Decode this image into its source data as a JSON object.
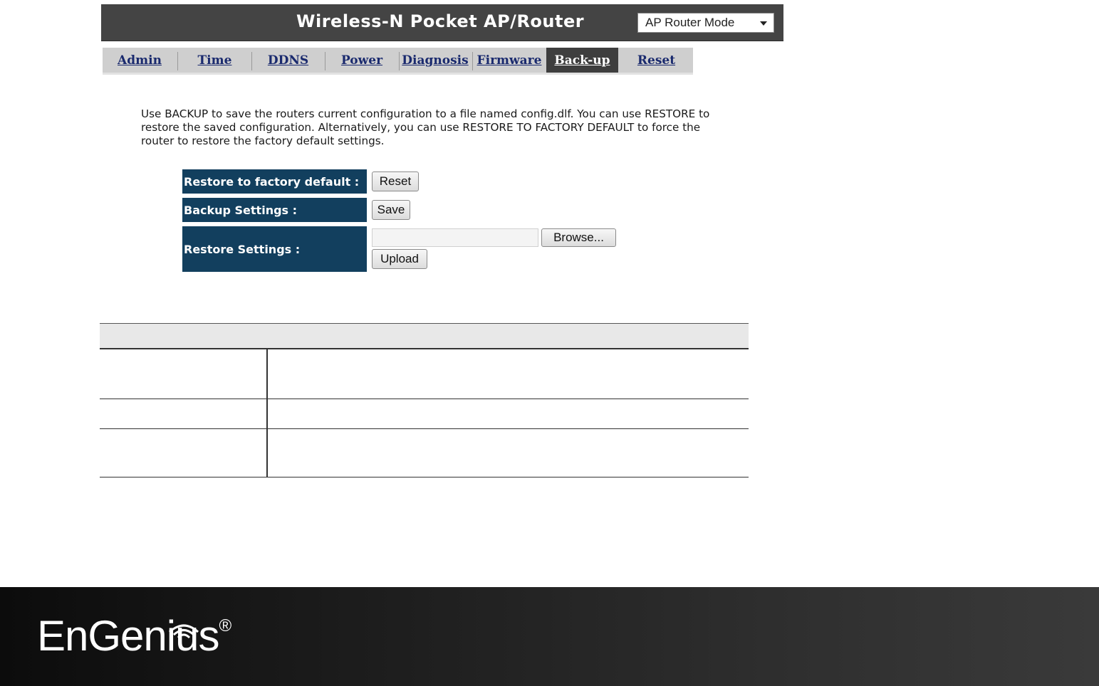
{
  "header": {
    "title": "Wireless-N Pocket AP/Router",
    "mode_select": {
      "selected": "AP Router Mode"
    }
  },
  "tabs": [
    {
      "label": "Admin"
    },
    {
      "label": "Time"
    },
    {
      "label": "DDNS"
    },
    {
      "label": "Power"
    },
    {
      "label": "Diagnosis"
    },
    {
      "label": "Firmware"
    },
    {
      "label": "Back-up",
      "active": true
    },
    {
      "label": "Reset"
    }
  ],
  "description": "Use BACKUP to save the routers current configuration to a file named config.dlf. You can use RESTORE to restore the saved configuration. Alternatively, you can use RESTORE TO FACTORY DEFAULT to force the router to restore the factory default settings.",
  "settings": {
    "factory_default": {
      "label": "Restore to factory default :",
      "button": "Reset"
    },
    "backup": {
      "label": "Backup Settings :",
      "button": "Save"
    },
    "restore": {
      "label": "Restore Settings :",
      "file_value": "",
      "browse_button": "Browse...",
      "upload_button": "Upload"
    }
  },
  "footer": {
    "logo_text": "EnGenius",
    "logo_mark": "®"
  },
  "colors": {
    "header_bg": "#444444",
    "tab_bg": "#cfcfcf",
    "tab_active_bg": "#3e3e3e",
    "tab_text": "#1a2a6e",
    "label_bg": "#123f5e",
    "footer_bg": "#1b1b1b"
  }
}
